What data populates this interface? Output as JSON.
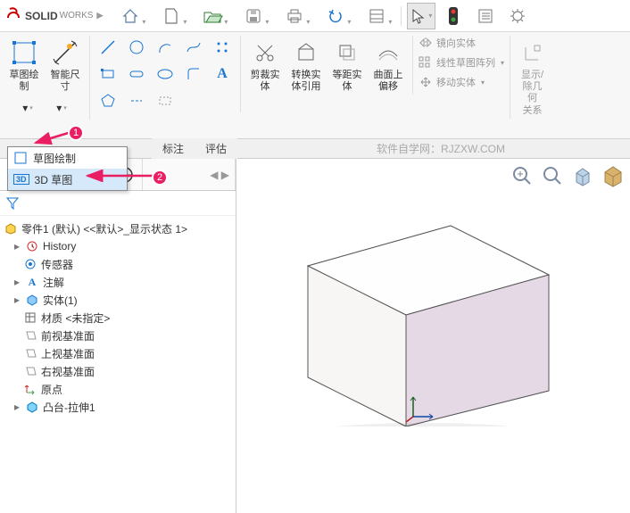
{
  "app": {
    "name": "SOLID",
    "name2": "WORKS"
  },
  "menubar_icons": [
    "home-icon",
    "new-icon",
    "open-icon",
    "save-icon",
    "print-icon",
    "undo-icon",
    "redo-icon",
    "options-icon",
    "cursor-icon",
    "traffic-icon",
    "list-icon",
    "settings-icon"
  ],
  "ribbon": {
    "sketch_label": "草图绘\n制",
    "smart_dim_label": "智能尺\n寸",
    "trim_label": "剪裁实\n体",
    "convert_label": "转换实\n体引用",
    "offset_label": "等距实\n体",
    "surface_offset_label": "曲面上\n偏移",
    "mirror_label": "镜向实体",
    "linear_pattern_label": "线性草图阵列",
    "move_label": "移动实体",
    "show_rel_label": "显示/\n除几何\n关系"
  },
  "tabs": {
    "t1": "标注",
    "t2": "评估"
  },
  "watermark": "软件自学网：RJZXW.COM",
  "dropdown": {
    "item1": "草图绘制",
    "item2": "3D 草图",
    "prefix3d": "3D"
  },
  "anno": {
    "n1": "1",
    "n2": "2"
  },
  "tree": {
    "root": "零件1 (默认) <<默认>_显示状态 1>",
    "history": "History",
    "sensors": "传感器",
    "annotations": "注解",
    "solid": "实体(1)",
    "material": "材质 <未指定>",
    "front": "前视基准面",
    "top": "上视基准面",
    "right": "右视基准面",
    "origin": "原点",
    "feature": "凸台-拉伸1"
  }
}
